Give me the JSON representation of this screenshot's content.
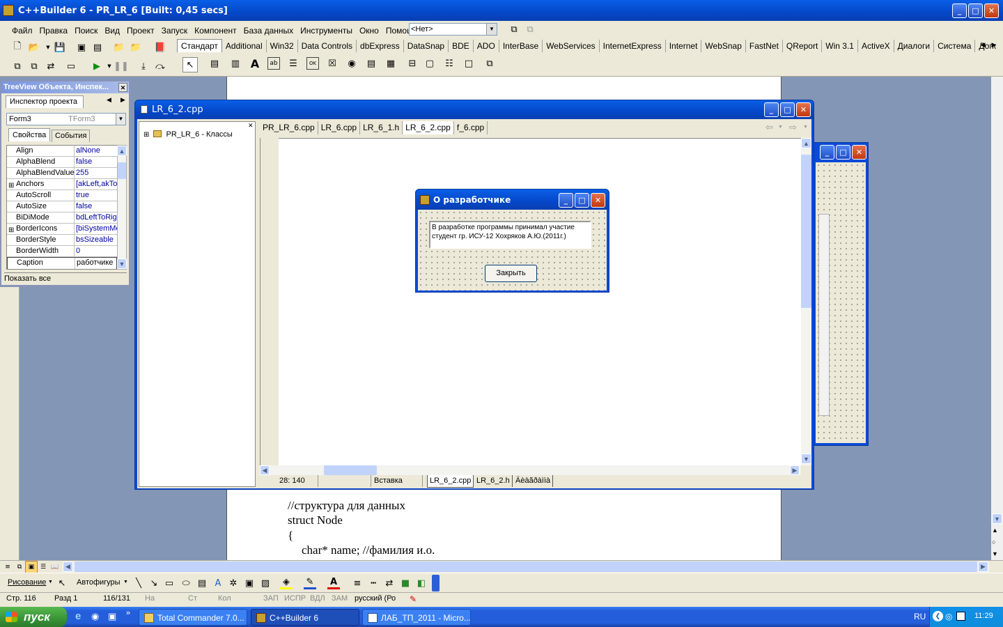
{
  "app": {
    "title": "C++Builder 6 - PR_LR_6 [Built: 0,45 secs]"
  },
  "menu": [
    "Файл",
    "Правка",
    "Поиск",
    "Вид",
    "Проект",
    "Запуск",
    "Компонент",
    "База данных",
    "Инструменты",
    "Окно",
    "Помощь"
  ],
  "desktop_combo": "<Нет>",
  "palette_tabs": [
    "Стандарт",
    "Additional",
    "Win32",
    "Data Controls",
    "dbExpress",
    "DataSnap",
    "BDE",
    "ADO",
    "InterBase",
    "WebServices",
    "InternetExpress",
    "Internet",
    "WebSnap",
    "FastNet",
    "QReport",
    "Win 3.1",
    "ActiveX",
    "Диалоги",
    "Система",
    "Дополнител"
  ],
  "inspector": {
    "title": "TreeView Объекта, Инспек...",
    "tab": "Инспектор проекта",
    "object_name": "Form3",
    "object_type": "TForm3",
    "tabs": [
      "Свойства",
      "События"
    ],
    "rows": [
      {
        "key": "Align",
        "value": "alNone"
      },
      {
        "key": "AlphaBlend",
        "value": "false"
      },
      {
        "key": "AlphaBlendValue",
        "value": "255"
      },
      {
        "key": "Anchors",
        "value": "[akLeft,akTo"
      },
      {
        "key": "AutoScroll",
        "value": "true"
      },
      {
        "key": "AutoSize",
        "value": "false"
      },
      {
        "key": "BiDiMode",
        "value": "bdLeftToRig"
      },
      {
        "key": "BorderIcons",
        "value": "[biSystemMe"
      },
      {
        "key": "BorderStyle",
        "value": "bsSizeable"
      },
      {
        "key": "BorderWidth",
        "value": "0"
      },
      {
        "key": "Caption",
        "value": "работчике"
      }
    ],
    "footer": "Показать все"
  },
  "editor": {
    "title": "LR_6_2.cpp",
    "tree_item": "PR_LR_6 - Классы",
    "tabs": [
      "PR_LR_6.cpp",
      "LR_6.cpp",
      "LR_6_1.h",
      "LR_6_2.cpp",
      "f_6.cpp"
    ],
    "status": {
      "pos": "28: 140",
      "mode": "Вставка",
      "tabs": [
        "LR_6_2.cpp",
        "LR_6_2.h",
        "Äèàãðàììà"
      ]
    }
  },
  "dialog": {
    "title": "О разработчике",
    "text": "В разработке программы принимал участие студент гр. ИСУ-12  Хохряков А.Ю.(2011г.)",
    "button": "Закрыть"
  },
  "document": {
    "lines": [
      "//структура для данных",
      "struct Node",
      "{",
      "char* name;    //фамилия и.о."
    ]
  },
  "word_drawing": {
    "draw": "Рисование",
    "autoshapes": "Автофигуры"
  },
  "word_status": [
    "Стр. 116",
    "Разд 1",
    "116/131",
    "На",
    "Ст",
    "Кол",
    "ЗАП",
    "ИСПР",
    "ВДЛ",
    "ЗАМ",
    "русский (Ро"
  ],
  "taskbar": {
    "start": "пуск",
    "items": [
      "Total Commander 7.0...",
      "C++Builder 6",
      "ЛАБ_ТП_2011 - Micro..."
    ],
    "lang": "RU",
    "time": "11:29"
  }
}
